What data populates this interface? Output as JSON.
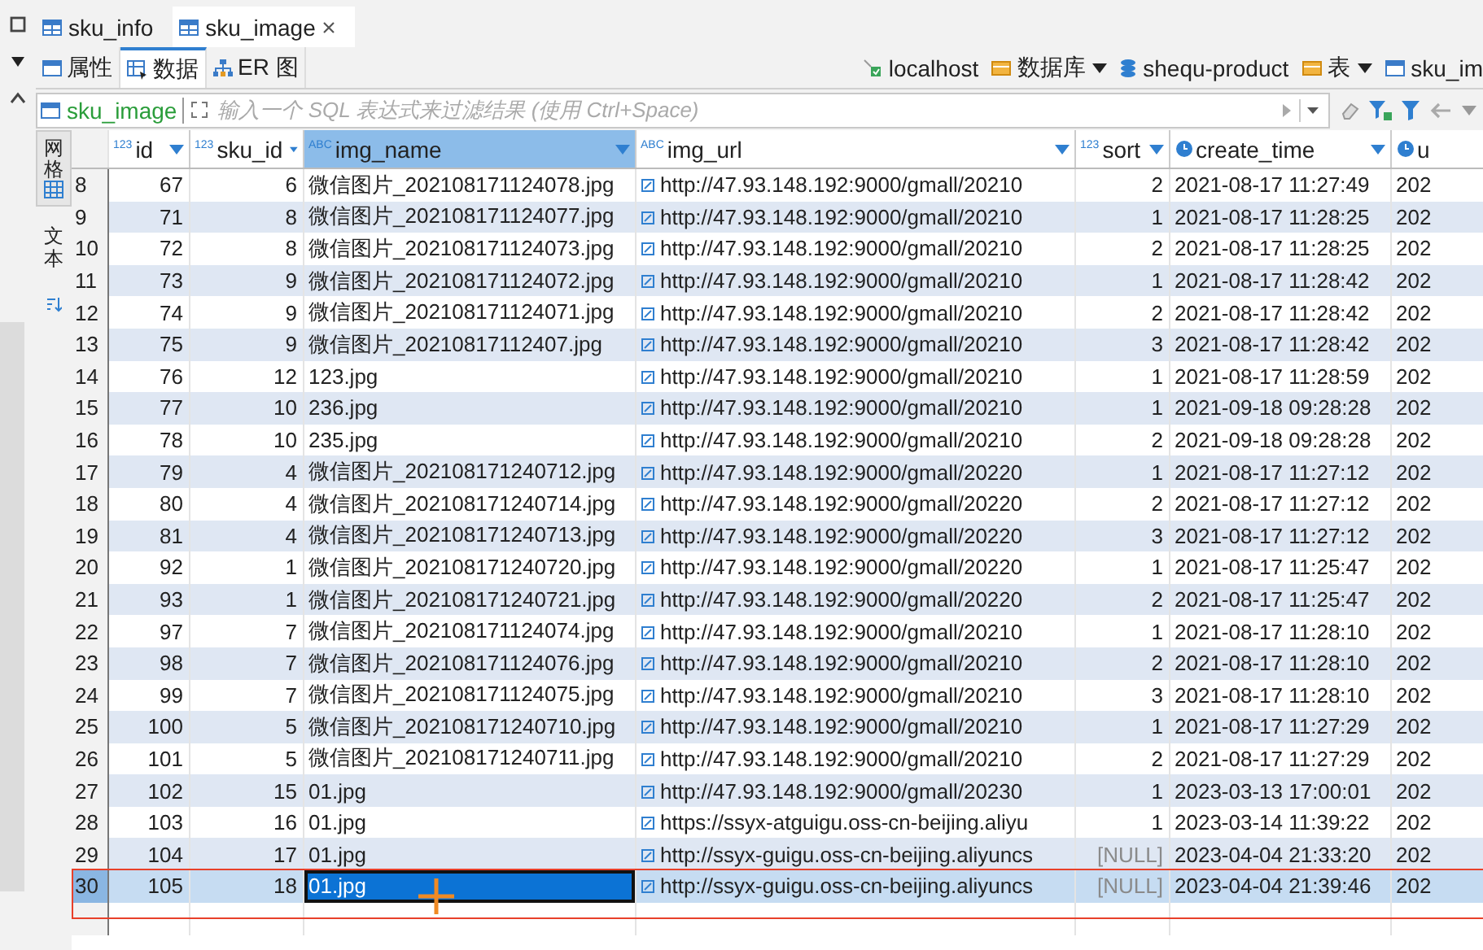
{
  "tabs": [
    {
      "label": "sku_info",
      "selected": false,
      "closable": false
    },
    {
      "label": "sku_image",
      "selected": true,
      "closable": true
    }
  ],
  "subtabs": [
    {
      "label": "属性",
      "selected": false
    },
    {
      "label": "数据",
      "selected": true
    },
    {
      "label": "ER 图",
      "selected": false
    }
  ],
  "breadcrumb": [
    {
      "label": "localhost",
      "dropdown": false
    },
    {
      "label": "数据库",
      "dropdown": true
    },
    {
      "label": "shequ-product",
      "dropdown": false
    },
    {
      "label": "表",
      "dropdown": true
    },
    {
      "label": "sku_im",
      "dropdown": false
    }
  ],
  "filter": {
    "table": "sku_image",
    "placeholder": "输入一个 SQL 表达式来过滤结果 (使用 Ctrl+Space)"
  },
  "side_tabs": [
    {
      "label": "网格",
      "selected": true
    },
    {
      "label": "文本",
      "selected": false
    }
  ],
  "table": {
    "columns": [
      {
        "label": "id",
        "kind": "number",
        "type_label": "123",
        "selected": false
      },
      {
        "label": "sku_id",
        "kind": "number",
        "type_label": "123",
        "selected": false
      },
      {
        "label": "img_name",
        "kind": "text",
        "type_label": "ABC",
        "selected": true
      },
      {
        "label": "img_url",
        "kind": "link",
        "type_label": "ABC",
        "selected": false
      },
      {
        "label": "sort",
        "kind": "number",
        "type_label": "123",
        "selected": false
      },
      {
        "label": "create_time",
        "kind": "datetime",
        "selected": false
      },
      {
        "label": "u",
        "kind": "datetime",
        "selected": false
      }
    ],
    "rows": [
      {
        "num": "8",
        "cells": [
          "67",
          "6",
          "微信图片_202108171124078.jpg",
          "http://47.93.148.192:9000/gmall/20210",
          "2",
          "2021-08-17 11:27:49",
          "202"
        ],
        "selected": false,
        "name_focused": false,
        "sort_null": false
      },
      {
        "num": "9",
        "cells": [
          "71",
          "8",
          "微信图片_202108171124077.jpg",
          "http://47.93.148.192:9000/gmall/20210",
          "1",
          "2021-08-17 11:28:25",
          "202"
        ],
        "selected": false,
        "name_focused": false,
        "sort_null": false
      },
      {
        "num": "10",
        "cells": [
          "72",
          "8",
          "微信图片_202108171124073.jpg",
          "http://47.93.148.192:9000/gmall/20210",
          "2",
          "2021-08-17 11:28:25",
          "202"
        ],
        "selected": false,
        "name_focused": false,
        "sort_null": false
      },
      {
        "num": "11",
        "cells": [
          "73",
          "9",
          "微信图片_202108171124072.jpg",
          "http://47.93.148.192:9000/gmall/20210",
          "1",
          "2021-08-17 11:28:42",
          "202"
        ],
        "selected": false,
        "name_focused": false,
        "sort_null": false
      },
      {
        "num": "12",
        "cells": [
          "74",
          "9",
          "微信图片_202108171124071.jpg",
          "http://47.93.148.192:9000/gmall/20210",
          "2",
          "2021-08-17 11:28:42",
          "202"
        ],
        "selected": false,
        "name_focused": false,
        "sort_null": false
      },
      {
        "num": "13",
        "cells": [
          "75",
          "9",
          "微信图片_20210817112407.jpg",
          "http://47.93.148.192:9000/gmall/20210",
          "3",
          "2021-08-17 11:28:42",
          "202"
        ],
        "selected": false,
        "name_focused": false,
        "sort_null": false
      },
      {
        "num": "14",
        "cells": [
          "76",
          "12",
          "123.jpg",
          "http://47.93.148.192:9000/gmall/20210",
          "1",
          "2021-08-17 11:28:59",
          "202"
        ],
        "selected": false,
        "name_focused": false,
        "sort_null": false
      },
      {
        "num": "15",
        "cells": [
          "77",
          "10",
          "236.jpg",
          "http://47.93.148.192:9000/gmall/20210",
          "1",
          "2021-09-18 09:28:28",
          "202"
        ],
        "selected": false,
        "name_focused": false,
        "sort_null": false
      },
      {
        "num": "16",
        "cells": [
          "78",
          "10",
          "235.jpg",
          "http://47.93.148.192:9000/gmall/20210",
          "2",
          "2021-09-18 09:28:28",
          "202"
        ],
        "selected": false,
        "name_focused": false,
        "sort_null": false
      },
      {
        "num": "17",
        "cells": [
          "79",
          "4",
          "微信图片_202108171240712.jpg",
          "http://47.93.148.192:9000/gmall/20220",
          "1",
          "2021-08-17 11:27:12",
          "202"
        ],
        "selected": false,
        "name_focused": false,
        "sort_null": false
      },
      {
        "num": "18",
        "cells": [
          "80",
          "4",
          "微信图片_202108171240714.jpg",
          "http://47.93.148.192:9000/gmall/20220",
          "2",
          "2021-08-17 11:27:12",
          "202"
        ],
        "selected": false,
        "name_focused": false,
        "sort_null": false
      },
      {
        "num": "19",
        "cells": [
          "81",
          "4",
          "微信图片_202108171240713.jpg",
          "http://47.93.148.192:9000/gmall/20220",
          "3",
          "2021-08-17 11:27:12",
          "202"
        ],
        "selected": false,
        "name_focused": false,
        "sort_null": false
      },
      {
        "num": "20",
        "cells": [
          "92",
          "1",
          "微信图片_202108171240720.jpg",
          "http://47.93.148.192:9000/gmall/20220",
          "1",
          "2021-08-17 11:25:47",
          "202"
        ],
        "selected": false,
        "name_focused": false,
        "sort_null": false
      },
      {
        "num": "21",
        "cells": [
          "93",
          "1",
          "微信图片_202108171240721.jpg",
          "http://47.93.148.192:9000/gmall/20220",
          "2",
          "2021-08-17 11:25:47",
          "202"
        ],
        "selected": false,
        "name_focused": false,
        "sort_null": false
      },
      {
        "num": "22",
        "cells": [
          "97",
          "7",
          "微信图片_202108171124074.jpg",
          "http://47.93.148.192:9000/gmall/20210",
          "1",
          "2021-08-17 11:28:10",
          "202"
        ],
        "selected": false,
        "name_focused": false,
        "sort_null": false
      },
      {
        "num": "23",
        "cells": [
          "98",
          "7",
          "微信图片_202108171124076.jpg",
          "http://47.93.148.192:9000/gmall/20210",
          "2",
          "2021-08-17 11:28:10",
          "202"
        ],
        "selected": false,
        "name_focused": false,
        "sort_null": false
      },
      {
        "num": "24",
        "cells": [
          "99",
          "7",
          "微信图片_202108171124075.jpg",
          "http://47.93.148.192:9000/gmall/20210",
          "3",
          "2021-08-17 11:28:10",
          "202"
        ],
        "selected": false,
        "name_focused": false,
        "sort_null": false
      },
      {
        "num": "25",
        "cells": [
          "100",
          "5",
          "微信图片_202108171240710.jpg",
          "http://47.93.148.192:9000/gmall/20210",
          "1",
          "2021-08-17 11:27:29",
          "202"
        ],
        "selected": false,
        "name_focused": false,
        "sort_null": false
      },
      {
        "num": "26",
        "cells": [
          "101",
          "5",
          "微信图片_202108171240711.jpg",
          "http://47.93.148.192:9000/gmall/20210",
          "2",
          "2021-08-17 11:27:29",
          "202"
        ],
        "selected": false,
        "name_focused": false,
        "sort_null": false
      },
      {
        "num": "27",
        "cells": [
          "102",
          "15",
          "01.jpg",
          "http://47.93.148.192:9000/gmall/20230",
          "1",
          "2023-03-13 17:00:01",
          "202"
        ],
        "selected": false,
        "name_focused": false,
        "sort_null": false
      },
      {
        "num": "28",
        "cells": [
          "103",
          "16",
          "01.jpg",
          "https://ssyx-atguigu.oss-cn-beijing.aliyu",
          "1",
          "2023-03-14 11:39:22",
          "202"
        ],
        "selected": false,
        "name_focused": false,
        "sort_null": false
      },
      {
        "num": "29",
        "cells": [
          "104",
          "17",
          "01.jpg",
          "http://ssyx-guigu.oss-cn-beijing.aliyuncs",
          "[NULL]",
          "2023-04-04 21:33:20",
          "202"
        ],
        "selected": false,
        "name_focused": false,
        "sort_null": true
      },
      {
        "num": "30",
        "cells": [
          "105",
          "18",
          "01.jpg",
          "http://ssyx-guigu.oss-cn-beijing.aliyuncs",
          "[NULL]",
          "2023-04-04 21:39:46",
          "202"
        ],
        "selected": true,
        "name_focused": true,
        "sort_null": true
      }
    ]
  }
}
